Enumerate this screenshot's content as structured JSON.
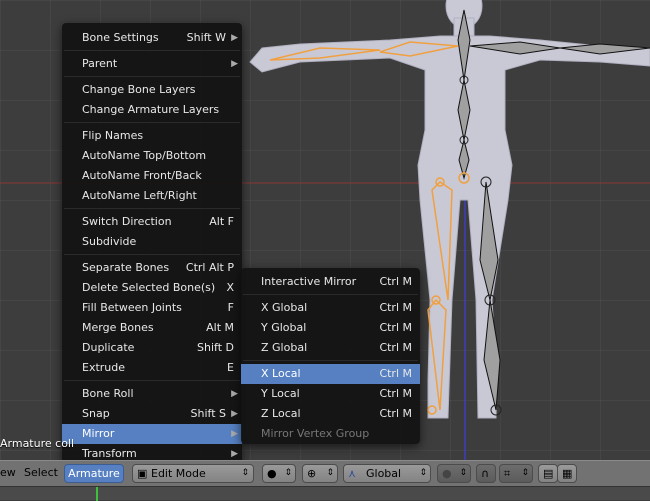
{
  "context_menu": {
    "items": [
      {
        "label": "Bone Settings",
        "shortcut": "Shift W",
        "submenu": true
      },
      {
        "label": "Parent",
        "shortcut": "",
        "submenu": true
      },
      {
        "label": "Change Bone Layers",
        "shortcut": ""
      },
      {
        "label": "Change Armature Layers",
        "shortcut": ""
      },
      {
        "label": "Flip Names",
        "shortcut": ""
      },
      {
        "label": "AutoName Top/Bottom",
        "shortcut": ""
      },
      {
        "label": "AutoName Front/Back",
        "shortcut": ""
      },
      {
        "label": "AutoName Left/Right",
        "shortcut": ""
      },
      {
        "label": "Switch Direction",
        "shortcut": "Alt F"
      },
      {
        "label": "Subdivide",
        "shortcut": ""
      },
      {
        "label": "Separate Bones",
        "shortcut": "Ctrl Alt P"
      },
      {
        "label": "Delete Selected Bone(s)",
        "shortcut": "X"
      },
      {
        "label": "Fill Between Joints",
        "shortcut": "F"
      },
      {
        "label": "Merge Bones",
        "shortcut": "Alt M"
      },
      {
        "label": "Duplicate",
        "shortcut": "Shift D"
      },
      {
        "label": "Extrude",
        "shortcut": "E"
      },
      {
        "label": "Bone Roll",
        "shortcut": "",
        "submenu": true
      },
      {
        "label": "Snap",
        "shortcut": "Shift S",
        "submenu": true
      },
      {
        "label": "Mirror",
        "shortcut": "",
        "submenu": true,
        "highlighted": true
      },
      {
        "label": "Transform",
        "shortcut": "",
        "submenu": true
      }
    ]
  },
  "mirror_submenu": {
    "items": [
      {
        "label": "Interactive Mirror",
        "shortcut": "Ctrl M"
      },
      {
        "label": "X Global",
        "shortcut": "Ctrl M"
      },
      {
        "label": "Y Global",
        "shortcut": "Ctrl M"
      },
      {
        "label": "Z Global",
        "shortcut": "Ctrl M"
      },
      {
        "label": "X Local",
        "shortcut": "Ctrl M",
        "highlighted": true
      },
      {
        "label": "Y Local",
        "shortcut": "Ctrl M"
      },
      {
        "label": "Z Local",
        "shortcut": "Ctrl M"
      },
      {
        "label": "Mirror Vertex Group",
        "shortcut": "",
        "disabled": true
      }
    ]
  },
  "status": {
    "text": "Armature coll"
  },
  "header": {
    "view_label": "ew",
    "select_label": "Select",
    "armature_label": "Armature",
    "mode_label": "Edit Mode",
    "orientation_label": "Global"
  },
  "colors": {
    "highlight": "#5680c2",
    "selected_bone": "#f0a040",
    "body": "#c8c8d4"
  },
  "icons": [
    "submenu-arrow-icon",
    "mode-cube-icon",
    "shading-sphere-icon",
    "pivot-icon",
    "manipulator-icon",
    "proportional-icon",
    "snap-icon",
    "render-icon",
    "clapper-icon"
  ]
}
